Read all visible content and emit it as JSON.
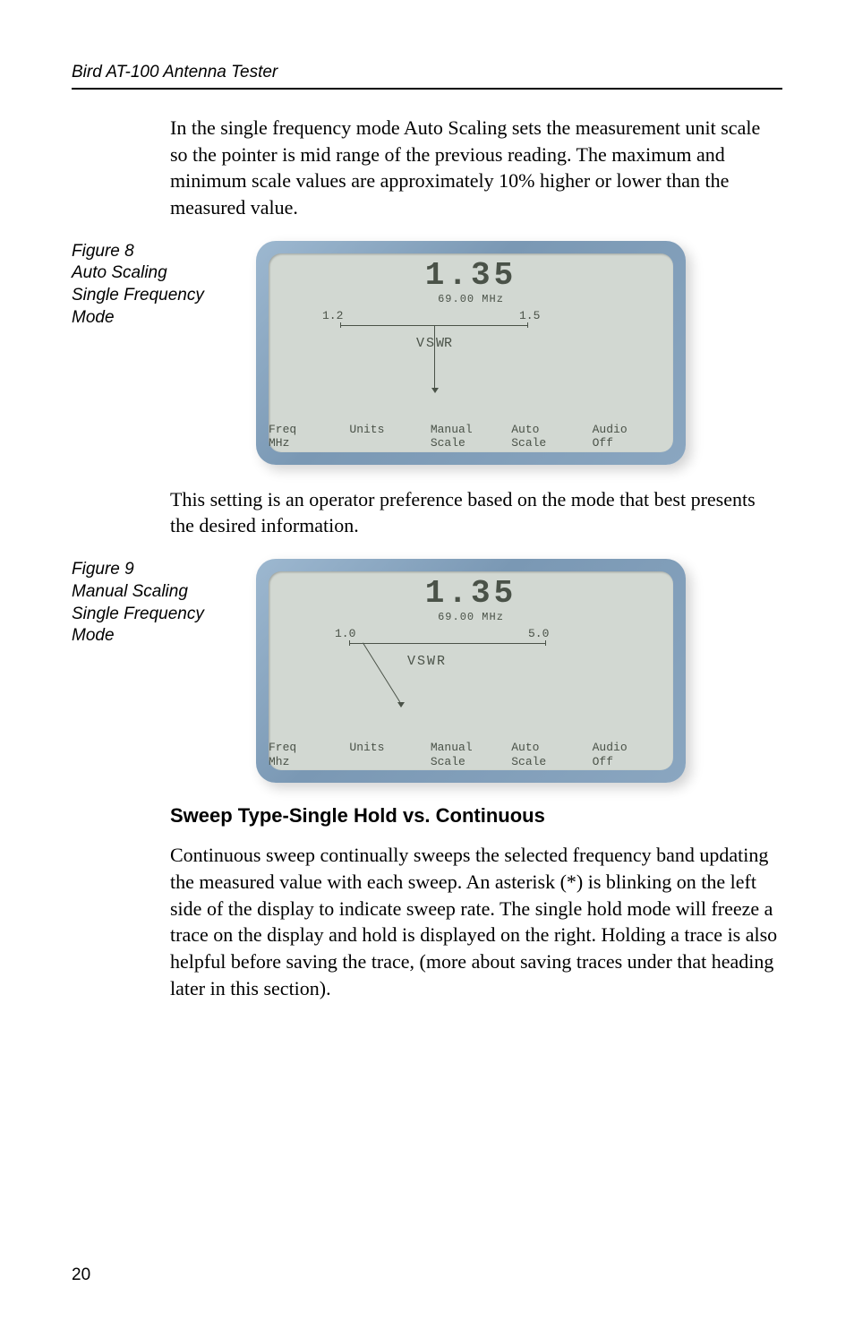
{
  "header": {
    "title": "Bird AT-100 Antenna Tester"
  },
  "para1": "In the single frequency mode Auto Scaling sets the measurement unit scale so the pointer is mid range of the previous reading. The maximum and minimum scale values are approximately 10% higher or lower than the measured value.",
  "fig8": {
    "caption_l1": "Figure 8",
    "caption_l2": "Auto Scaling Single Frequency Mode",
    "reading": "1.35",
    "freq": "69.00 MHz",
    "axis_left": "1.2",
    "axis_right": "1.5",
    "unit_label": "VSWR",
    "sk1a": "Freq",
    "sk1b": "MHz",
    "sk2a": "Units",
    "sk2b": "",
    "sk3a": "Manual",
    "sk3b": "Scale",
    "sk4a": "Auto",
    "sk4b": "Scale",
    "sk5a": "Audio",
    "sk5b": "Off"
  },
  "para2": "This setting is an operator preference based on the mode that best presents the desired information.",
  "fig9": {
    "caption_l1": "Figure 9",
    "caption_l2": "Manual Scaling Single Frequency Mode",
    "reading": "1.35",
    "freq": "69.00 MHz",
    "axis_left": "1.0",
    "axis_right": "5.0",
    "unit_label": "VSWR",
    "sk1a": "Freq",
    "sk1b": "Mhz",
    "sk2a": "Units",
    "sk2b": "",
    "sk3a": "Manual",
    "sk3b": "Scale",
    "sk4a": "Auto",
    "sk4b": "Scale",
    "sk5a": "Audio",
    "sk5b": "Off"
  },
  "section": {
    "title": "Sweep Type-Single Hold vs. Continuous"
  },
  "para3": "Continuous sweep continually sweeps the selected frequency band updating the measured value with each sweep. An asterisk (*) is blinking on the left side of the display to indicate sweep rate. The single hold mode will freeze a trace on the display and hold is displayed on the right. Holding a trace is also helpful before saving the trace, (more about saving traces under that heading later in this section).",
  "page": "20",
  "chart_data": [
    {
      "type": "scale-indicator",
      "figure": 8,
      "title": "Auto Scaling Single Frequency Mode",
      "reading_value": 1.35,
      "reading_unit": "VSWR",
      "frequency_mhz": 69.0,
      "scale_min": 1.2,
      "scale_max": 1.5,
      "softkeys": [
        "Freq MHz",
        "Units",
        "Manual Scale",
        "Auto Scale",
        "Audio Off"
      ]
    },
    {
      "type": "scale-indicator",
      "figure": 9,
      "title": "Manual Scaling Single Frequency Mode",
      "reading_value": 1.35,
      "reading_unit": "VSWR",
      "frequency_mhz": 69.0,
      "scale_min": 1.0,
      "scale_max": 5.0,
      "softkeys": [
        "Freq Mhz",
        "Units",
        "Manual Scale",
        "Auto Scale",
        "Audio Off"
      ]
    }
  ]
}
